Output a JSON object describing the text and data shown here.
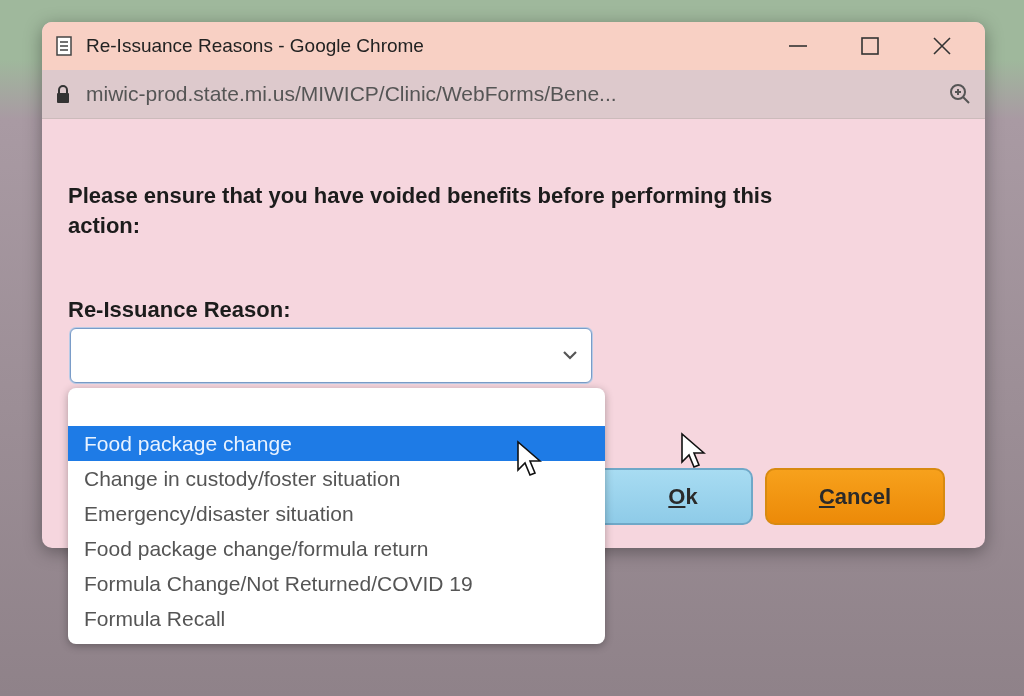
{
  "window": {
    "title": "Re-Issuance Reasons - Google Chrome"
  },
  "address_bar": {
    "url": "miwic-prod.state.mi.us/MIWICP/Clinic/WebForms/Bene..."
  },
  "message": "Please ensure that you have voided benefits before performing this action:",
  "field": {
    "label": "Re-Issuance Reason:",
    "expanded": true
  },
  "options": [
    {
      "label": "Food package change",
      "selected": true
    },
    {
      "label": "Change in custody/foster situation",
      "selected": false
    },
    {
      "label": "Emergency/disaster situation",
      "selected": false
    },
    {
      "label": "Food package change/formula return",
      "selected": false
    },
    {
      "label": "Formula Change/Not Returned/COVID 19",
      "selected": false
    },
    {
      "label": "Formula Recall",
      "selected": false
    }
  ],
  "buttons": [
    {
      "label": "Ok",
      "kind": "primary"
    },
    {
      "label": "Cancel",
      "kind": "secondary"
    }
  ]
}
